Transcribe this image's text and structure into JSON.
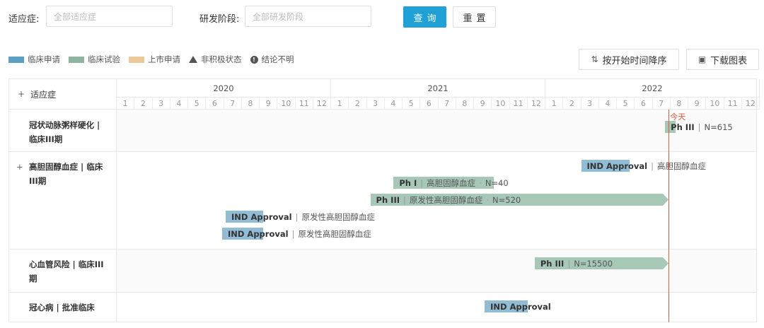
{
  "filters": {
    "indication_label": "适应症:",
    "indication_placeholder": "全部适应症",
    "stage_label": "研发阶段:",
    "stage_placeholder": "全部研发阶段",
    "query_button": "查询",
    "reset_button": "重置"
  },
  "legend": [
    {
      "label": "临床申请",
      "color": "#5b9fc3",
      "kind": "swatch"
    },
    {
      "label": "临床试验",
      "color": "#8fb3a0",
      "kind": "swatch"
    },
    {
      "label": "上市申请",
      "color": "#ecc99a",
      "kind": "swatch"
    },
    {
      "label": "非积极状态",
      "kind": "triangle"
    },
    {
      "label": "结论不明",
      "kind": "info"
    }
  ],
  "toolbar": {
    "sort_button": "按开始时间降序",
    "download_button": "下载图表"
  },
  "chart": {
    "header_label": "适应症",
    "years": [
      "2020",
      "2021",
      "2022"
    ],
    "months": [
      "1",
      "2",
      "3",
      "4",
      "5",
      "6",
      "7",
      "8",
      "9",
      "10",
      "11",
      "12"
    ],
    "today_label": "今天",
    "today": {
      "year": 2022,
      "month": 7.9
    },
    "colors": {
      "ind": "#91bcd3",
      "trial": "#a7c8b6",
      "today": "#e8593a"
    },
    "rows": [
      {
        "label": "冠状动脉粥样硬化 | 临床III期",
        "expandable": false,
        "shaded": true,
        "bars": [
          {
            "type": "trial",
            "start": [
              2022,
              7.7
            ],
            "end": [
              2022,
              8.3
            ],
            "main": "Ph III",
            "sub": "N=615",
            "arrow": false
          }
        ]
      },
      {
        "label": "高胆固醇血症 | 临床III期",
        "expandable": true,
        "shaded": false,
        "bars": [
          {
            "type": "ind",
            "start": [
              2022,
              3.0
            ],
            "end": [
              2022,
              5.7
            ],
            "main": "IND Approval",
            "sub": "高胆固醇血症",
            "arrow": false
          },
          {
            "type": "trial",
            "start": [
              2021,
              4.5
            ],
            "end": [
              2021,
              10.1
            ],
            "main": "Ph I",
            "sub": "高胆固醇血症",
            "sub2": "N=40",
            "arrow": false
          },
          {
            "type": "trial",
            "start": [
              2021,
              3.2
            ],
            "end": [
              2022,
              7.9
            ],
            "main": "Ph III",
            "sub": "原发性高胆固醇血症",
            "sub2": "N=520",
            "arrow": true
          },
          {
            "type": "ind",
            "start": [
              2020,
              7.1
            ],
            "end": [
              2020,
              9.2
            ],
            "main": "IND Approval",
            "sub": "原发性高胆固醇血症",
            "arrow": false
          },
          {
            "type": "ind",
            "start": [
              2020,
              6.9
            ],
            "end": [
              2020,
              9.2
            ],
            "main": "IND Approval",
            "sub": "原发性高胆固醇血症",
            "arrow": false
          }
        ]
      },
      {
        "label": "心血管风险 | 临床III期",
        "expandable": false,
        "shaded": true,
        "bars": [
          {
            "type": "trial",
            "start": [
              2021,
              12.4
            ],
            "end": [
              2022,
              7.9
            ],
            "main": "Ph III",
            "sub": "N=15500",
            "arrow": true
          }
        ]
      },
      {
        "label": "冠心病 | 批准临床",
        "expandable": false,
        "shaded": false,
        "bars": [
          {
            "type": "ind",
            "start": [
              2021,
              9.6
            ],
            "end": [
              2021,
              12.0
            ],
            "main": "IND Approval",
            "arrow": false
          }
        ]
      }
    ]
  }
}
